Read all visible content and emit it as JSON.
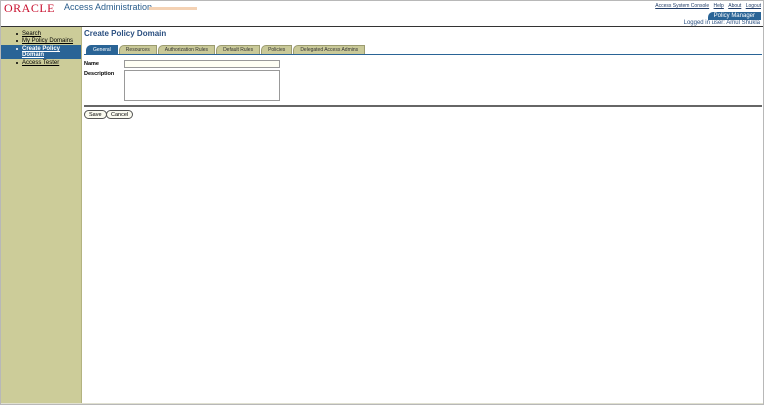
{
  "header": {
    "logo_text": "ORACLE",
    "app_title": "Access Administration",
    "links": [
      "Access System Console",
      "Help",
      "About",
      "Logout"
    ],
    "active_tab": "Policy Manager",
    "logged_in_text": "Logged in user: Amul Shukla"
  },
  "sidebar": {
    "items": [
      {
        "label": "Search",
        "active": false
      },
      {
        "label": "My Policy Domains",
        "active": false
      },
      {
        "label": "Create Policy Domain",
        "active": true
      },
      {
        "label": "Access Tester",
        "active": false
      }
    ]
  },
  "main": {
    "title": "Create Policy Domain",
    "tabs": [
      {
        "label": "General",
        "active": true
      },
      {
        "label": "Resources",
        "active": false
      },
      {
        "label": "Authorization Rules",
        "active": false
      },
      {
        "label": "Default Rules",
        "active": false
      },
      {
        "label": "Policies",
        "active": false
      },
      {
        "label": "Delegated Access Admins",
        "active": false
      }
    ],
    "form": {
      "name_label": "Name",
      "name_value": "",
      "description_label": "Description",
      "description_value": ""
    },
    "buttons": {
      "save": "Save",
      "cancel": "Cancel"
    }
  },
  "colors": {
    "brand_red": "#c8102e",
    "accent_blue": "#2a6496",
    "sidebar_bg": "#cccc99"
  }
}
